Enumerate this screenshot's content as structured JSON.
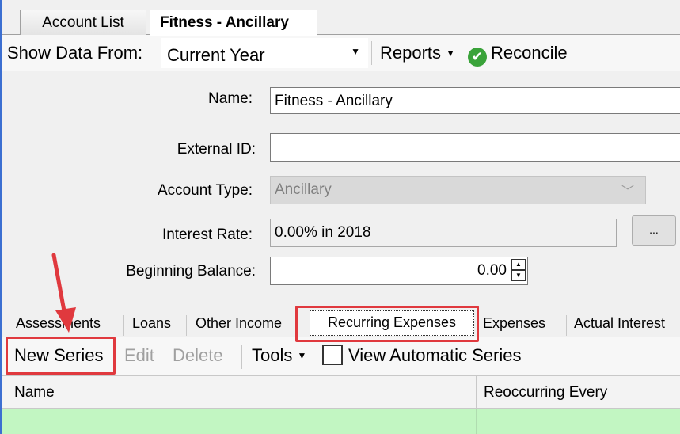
{
  "tabs": [
    {
      "label": "Account List",
      "active": false
    },
    {
      "label": "Fitness - Ancillary",
      "active": true
    }
  ],
  "toolbar": {
    "show_data_label": "Show Data From:",
    "show_data_value": "Current Year",
    "reports_label": "Reports",
    "reconcile_label": "Reconcile"
  },
  "form": {
    "name_label": "Name:",
    "name_value": "Fitness - Ancillary",
    "external_id_label": "External ID:",
    "external_id_value": "",
    "account_type_label": "Account Type:",
    "account_type_value": "Ancillary",
    "interest_rate_label": "Interest Rate:",
    "interest_rate_value": "0.00% in 2018",
    "interest_button_label": "...",
    "beginning_balance_label": "Beginning Balance:",
    "beginning_balance_value": "0.00"
  },
  "sub_tabs": [
    "Assessments",
    "Loans",
    "Other Income",
    "Recurring Expenses",
    "Expenses",
    "Actual Interest"
  ],
  "selected_sub_tab": "Recurring Expenses",
  "grid_toolbar": {
    "new_series": "New Series",
    "edit": "Edit",
    "delete": "Delete",
    "tools": "Tools",
    "view_automatic_series": "View Automatic Series",
    "view_automatic_checked": false
  },
  "grid": {
    "columns": [
      "Name",
      "Reoccurring Every"
    ]
  },
  "colors": {
    "highlight": "#e0393e",
    "row_selected": "#c2f6c2",
    "window_border": "#3c6fd1"
  }
}
